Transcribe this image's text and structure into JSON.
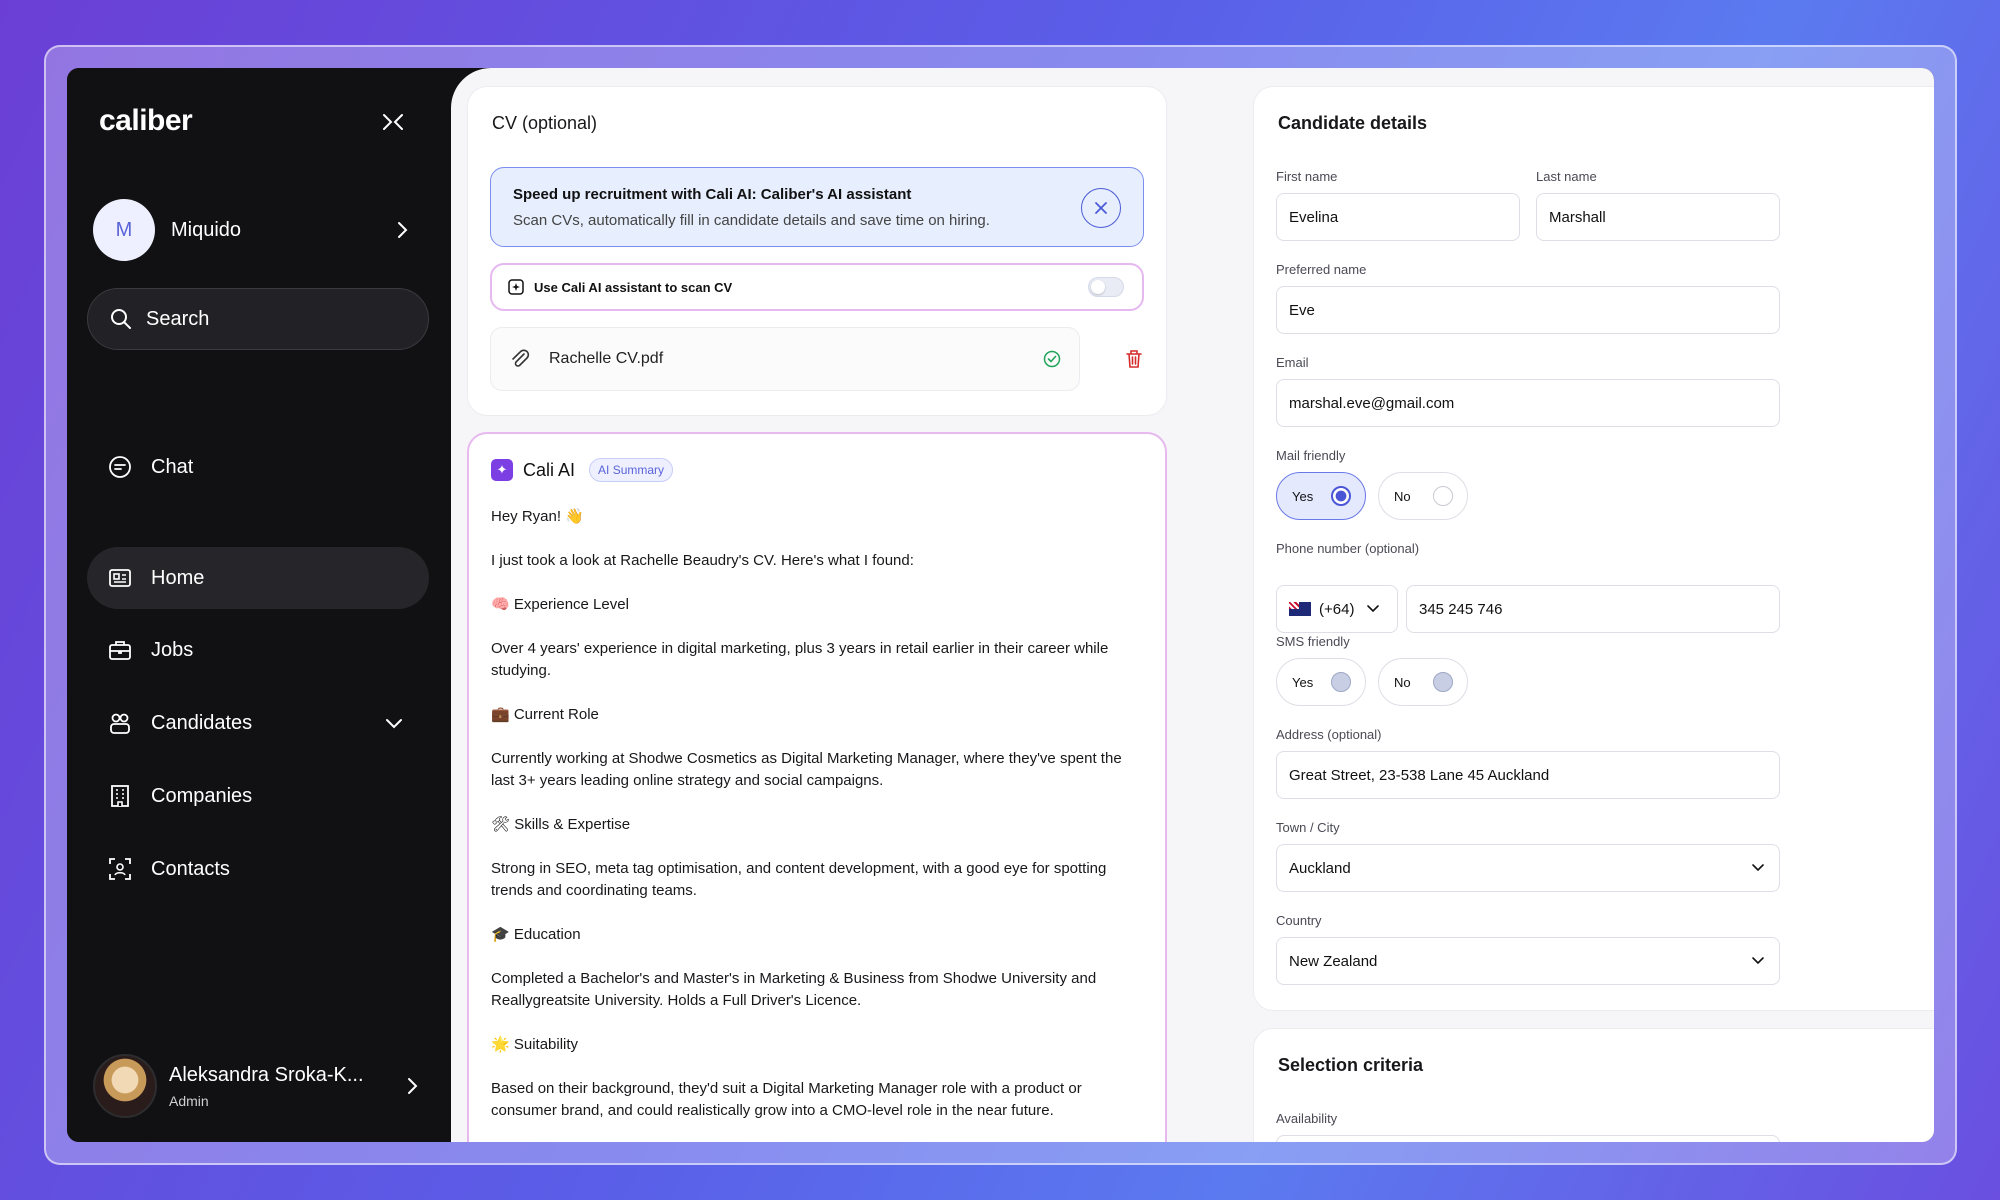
{
  "sidebar": {
    "logo": "caliber",
    "org": {
      "initial": "M",
      "name": "Miquido"
    },
    "search_label": "Search",
    "chat_label": "Chat",
    "nav": [
      {
        "label": "Home",
        "icon": "home-icon",
        "active": true
      },
      {
        "label": "Jobs",
        "icon": "briefcase-icon"
      },
      {
        "label": "Candidates",
        "icon": "candidates-icon"
      },
      {
        "label": "Companies",
        "icon": "building-icon"
      },
      {
        "label": "Contacts",
        "icon": "contacts-icon"
      }
    ],
    "user": {
      "name": "Aleksandra Sroka-K...",
      "role": "Admin"
    }
  },
  "cv": {
    "title": "CV (optional)",
    "banner_title": "Speed up recruitment with Cali AI: Caliber's AI assistant",
    "banner_sub": "Scan CVs, automatically fill in candidate details and save time on hiring.",
    "scan_label": "Use Cali AI assistant to scan CV",
    "scan_enabled": false,
    "file_name": "Rachelle  CV.pdf"
  },
  "ai": {
    "title": "Cali AI",
    "badge": "AI Summary",
    "paragraphs": [
      "Hey Ryan! 👋",
      "I just took a look at Rachelle Beaudry's CV. Here's what I found:",
      "🧠 Experience Level",
      "Over 4 years' experience in digital marketing, plus 3 years in retail earlier in their career while studying.",
      "💼 Current Role",
      "Currently working at Shodwe Cosmetics as Digital Marketing Manager, where they've spent the last 3+ years leading online strategy and social campaigns.",
      "🛠 Skills & Expertise",
      "Strong in SEO, meta tag optimisation, and content development, with a good eye for spotting trends and coordinating teams.",
      "🎓 Education",
      "Completed a Bachelor's and Master's in Marketing & Business from Shodwe University and Reallygreatsite University. Holds a Full Driver's Licence.",
      "🌟 Suitability",
      "Based on their background, they'd suit a Digital Marketing Manager role with a product or consumer brand, and could realistically grow into a CMO-level role in the near future."
    ]
  },
  "details": {
    "title": "Candidate details",
    "first_name_label": "First name",
    "first_name": "Evelina",
    "last_name_label": "Last name",
    "last_name": "Marshall",
    "preferred_label": "Preferred name",
    "preferred": "Eve",
    "email_label": "Email",
    "email": "marshal.eve@gmail.com",
    "mail_friendly_label": "Mail friendly",
    "yes": "Yes",
    "no": "No",
    "phone_label": "Phone number (optional)",
    "phone_code": "(+64)",
    "phone": "345 245 746",
    "sms_label": "SMS friendly",
    "address_label": "Address (optional)",
    "address": "Great Street, 23-538 Lane 45 Auckland",
    "town_label": "Town / City",
    "town": "Auckland",
    "country_label": "Country",
    "country": "New Zealand"
  },
  "selection": {
    "title": "Selection criteria",
    "availability_label": "Availability"
  }
}
